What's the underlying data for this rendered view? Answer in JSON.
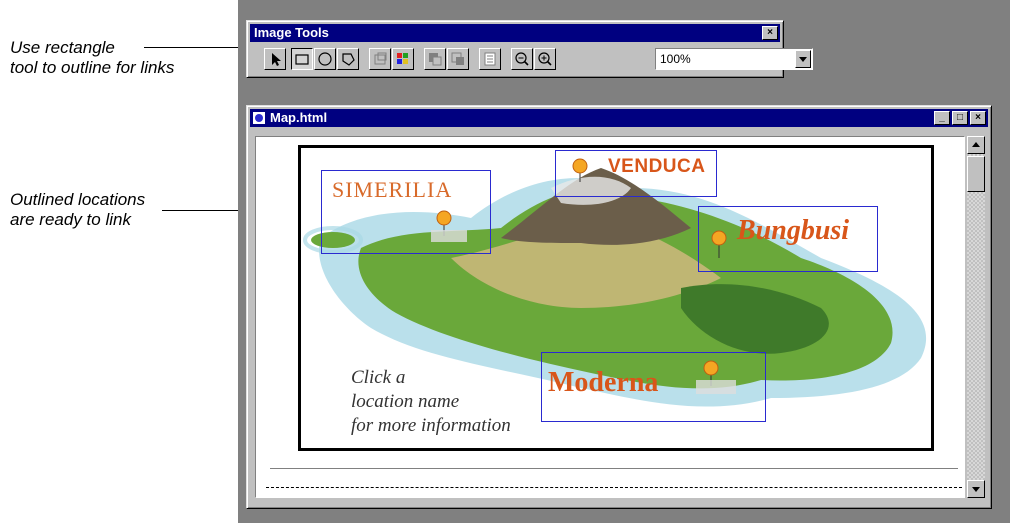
{
  "callouts": {
    "rectangle_tool": "Use rectangle\ntool to outline for links",
    "outlined_locations": "Outlined locations\nare ready to link"
  },
  "image_tools": {
    "title": "Image Tools",
    "close_label": "×",
    "tools": [
      "pointer-tool",
      "rectangle-tool",
      "circle-tool",
      "polygon-tool",
      "frame-tool",
      "color-tool",
      "bring-front-tool",
      "send-back-tool",
      "list-tool",
      "zoom-out-tool",
      "zoom-in-tool"
    ],
    "zoom_value": "100%"
  },
  "document_window": {
    "title": "Map.html",
    "min_label": "_",
    "max_label": "□",
    "close_label": "×"
  },
  "map": {
    "locations": [
      "SIMERILIA",
      "VENDUCA",
      "Bungbusi",
      "Moderna"
    ],
    "prompt": "Click a\nlocation name\nfor more information",
    "colors": {
      "outline": "#2a2ad0",
      "label": "#d8561a",
      "sea": "#7fc4d6",
      "land": "#5f9a3a",
      "mountain": "#7a6a50"
    }
  }
}
